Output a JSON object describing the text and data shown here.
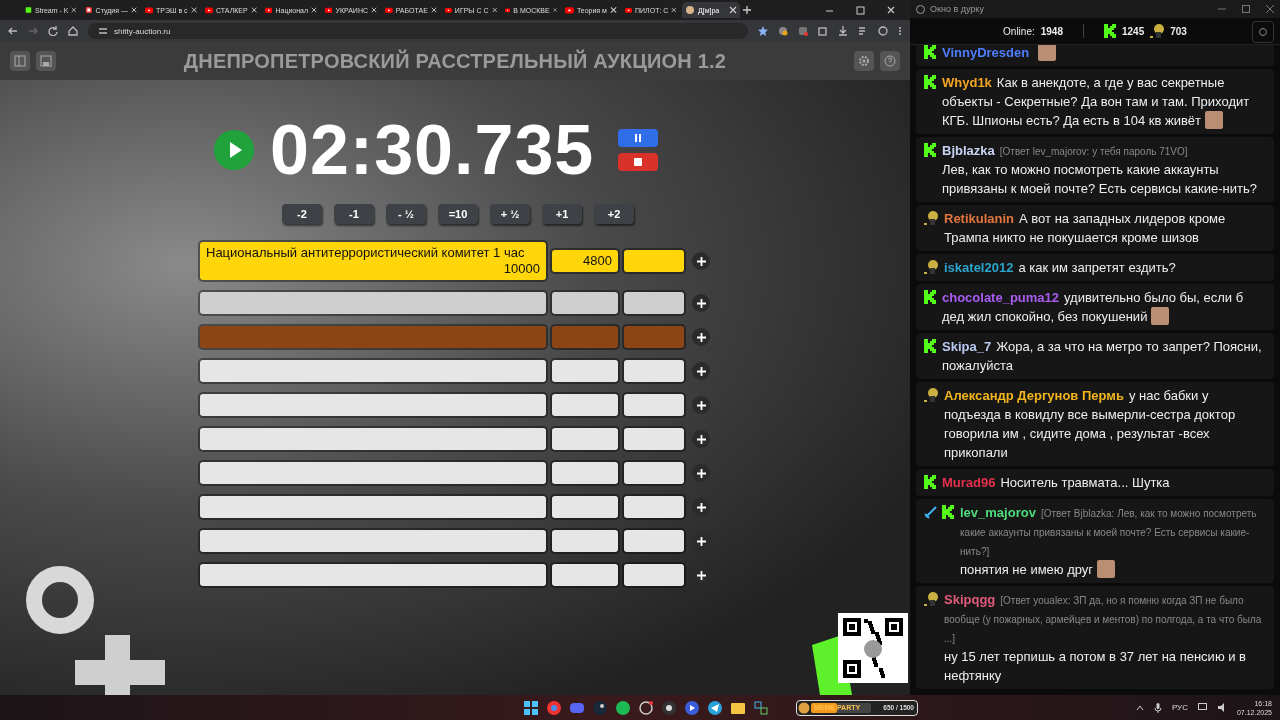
{
  "browser": {
    "tabs": [
      {
        "label": "Stream - K",
        "selected": false
      },
      {
        "label": "Студия —",
        "selected": false
      },
      {
        "label": "ТРЭШ в с",
        "selected": false
      },
      {
        "label": "СТАЛКЕР",
        "selected": false
      },
      {
        "label": "Национал",
        "selected": false
      },
      {
        "label": "УКРАИНС",
        "selected": false
      },
      {
        "label": "РАБОТАЕ",
        "selected": false
      },
      {
        "label": "ИГРЫ С С",
        "selected": false
      },
      {
        "label": "В МОСКВЕ",
        "selected": false
      },
      {
        "label": "Теория м",
        "selected": false
      },
      {
        "label": "ПИЛОТ: С",
        "selected": false
      },
      {
        "label": "Д[м]ра",
        "selected": true
      }
    ],
    "address": "shitty-auction.ru"
  },
  "auction": {
    "title": "ДНЕПРОПЕТРОВСКИЙ РАССТРЕЛЬНЫЙ АУКЦИОН 1.2",
    "timer": "02:30.735",
    "steps": [
      "-2",
      "-1",
      "- ½",
      "=10",
      "+ ½",
      "+1",
      "+2"
    ],
    "lots": [
      {
        "name": "Национальный антитеррористический комитет 1 час",
        "total": "10000",
        "price": "4800",
        "color": "#ffd60a"
      },
      {
        "color": "#cfcfcf"
      },
      {
        "color": "#8e4516"
      },
      {
        "color": "#e6e6e6"
      },
      {
        "color": "#e6e6e6"
      },
      {
        "color": "#e6e6e6"
      },
      {
        "color": "#e6e6e6"
      },
      {
        "color": "#e6e6e6"
      },
      {
        "color": "#e6e6e6"
      },
      {
        "color": "#e6e6e6"
      }
    ]
  },
  "chat": {
    "title": "Окно в дурку",
    "online_label": "Online:",
    "online": "1948",
    "kick_count": "1245",
    "emote_count": "703",
    "messages": [
      {
        "badges": [
          {
            "kind": "kick"
          }
        ],
        "user": "VinnyDresden",
        "color": "#4f7dff",
        "emote": true
      },
      {
        "badges": [
          {
            "kind": "kick"
          }
        ],
        "user": "Whyd1k",
        "color": "#f5a524",
        "text": "Как в анекдоте, а где у вас секретные объекты - Секретные? Да вон там и там. Приходит КГБ. Шпионы есть? Да есть в 104 кв живёт",
        "emote": true
      },
      {
        "badges": [
          {
            "kind": "kick"
          }
        ],
        "user": "Bjblazka",
        "color": "#c8d4f2",
        "reply": "[Ответ lev_majorov: у тебя пароль 71VO]",
        "text": "Лев, как то можно посмотреть какие аккаунты привязаны к моей почте? Есть сервисы какие-нить?"
      },
      {
        "badges": [
          {
            "kind": "figure"
          }
        ],
        "user": "Retikulanin",
        "color": "#e2753c",
        "text": "А вот на западных лидеров кроме Трампа никто не покушается кроме шизов"
      },
      {
        "badges": [
          {
            "kind": "figure"
          }
        ],
        "user": "iskatel2012",
        "color": "#2ba5cc",
        "text": "а как им запретят ездить?"
      },
      {
        "badges": [
          {
            "kind": "kick"
          }
        ],
        "user": "chocolate_puma12",
        "color": "#a95cf2",
        "text": "удивительно было бы, если б дед жил спокойно, без покушений",
        "emote": true
      },
      {
        "badges": [
          {
            "kind": "kick"
          }
        ],
        "user": "Skipa_7",
        "color": "#b9caf2",
        "text": "Жора, а за что на метро то запрет? Поясни, пожалуйста"
      },
      {
        "badges": [
          {
            "kind": "figure"
          }
        ],
        "user": "Александр Дергунов Пермь",
        "color": "#f2b51c",
        "text": "у нас бабки у подъезда в ковидлу все вымерли-сестра доктор говорила им , сидите дома , результат -всех прикопали"
      },
      {
        "badges": [
          {
            "kind": "kick"
          }
        ],
        "user": "Murad96",
        "color": "#e4304c",
        "text": "Носитель травмата... Шутка"
      },
      {
        "badges": [
          {
            "kind": "sword"
          },
          {
            "kind": "kick"
          }
        ],
        "user": "lev_majorov",
        "color": "#4fdc7c",
        "reply": "[Ответ Bjblazka: Лев, как то можно посмотреть какие аккаунты привязаны к моей почте? Есть сервисы какие-нить?]",
        "text": "понятия не имею друг",
        "emote": true
      },
      {
        "badges": [
          {
            "kind": "figure"
          }
        ],
        "user": "Skipqgg",
        "color": "#e25b7c",
        "reply": "[Ответ youalex: ЗП да, но я помню когда ЗП не было вообще (у пожарных, армейцев и ментов) по полгода, а та что была ...]",
        "text": "ну 15 лет терпишь а потом в 37 лет на пенсию и в нефтянку"
      }
    ]
  },
  "taskbar": {
    "apps": [
      {
        "kind": "start"
      },
      {
        "kind": "browser"
      },
      {
        "kind": "chat"
      },
      {
        "kind": "steam"
      },
      {
        "kind": "music"
      },
      {
        "kind": "camera"
      },
      {
        "kind": "record"
      },
      {
        "kind": "play"
      },
      {
        "kind": "send"
      },
      {
        "kind": "folder"
      },
      {
        "kind": "tool"
      }
    ],
    "meme_party": {
      "label": "MEME PARTY",
      "reading": "650 / 1500",
      "level": 0.43
    },
    "language": "РУС",
    "time": "16:18",
    "date": "07.12.2025"
  }
}
